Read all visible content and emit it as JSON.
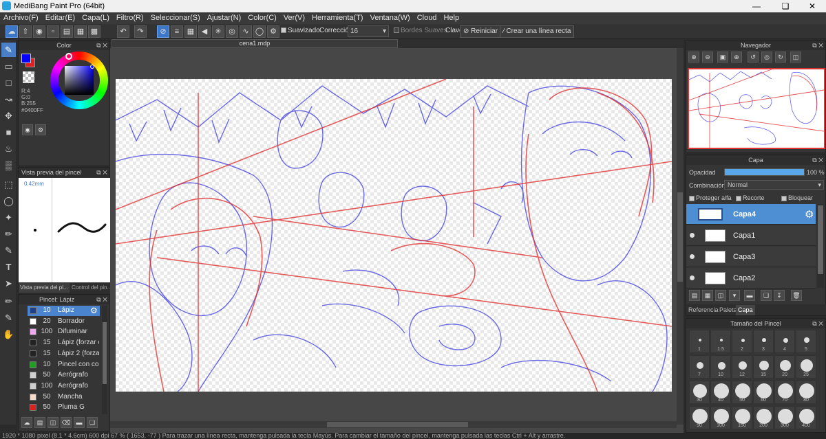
{
  "window": {
    "title": "MediBang Paint Pro (64bit)"
  },
  "menu": [
    "Archivo(F)",
    "Editar(E)",
    "Capa(L)",
    "Filtro(R)",
    "Seleccionar(S)",
    "Ajustar(N)",
    "Color(C)",
    "Ver(V)",
    "Herramienta(T)",
    "Ventana(W)",
    "Cloud",
    "Help"
  ],
  "toolbar": {
    "smoothing_label": "Suavizado",
    "correction_label": "Corrección",
    "correction_value": "16",
    "soft_edges_label": "Bordes Suaves",
    "key_label": "Clave",
    "reset_label": "Reiniciar",
    "straight_line_label": "Crear una línea recta"
  },
  "color_panel": {
    "title": "Color",
    "r": "R:4",
    "g": "G:0",
    "b": "B:255",
    "hex": "#0400FF",
    "primary_color": "#0400ff",
    "secondary_color": "#e02020"
  },
  "brush_preview": {
    "title": "Vista previa del pincel",
    "size": "0.42mm",
    "tab1": "Vista previa del pi...",
    "tab2": "Control del pin..."
  },
  "brush_panel": {
    "title": "Pincel: Lápiz",
    "items": [
      {
        "size": "10",
        "name": "Lápiz",
        "color": "#1e3f8c"
      },
      {
        "size": "20",
        "name": "Borrador",
        "color": "#ffffff"
      },
      {
        "size": "100",
        "name": "Difuminar",
        "color": "#f0a8f0"
      },
      {
        "size": "15",
        "name": "Lápiz (forzar c",
        "color": "#222222"
      },
      {
        "size": "15",
        "name": "Lápiz 2 (forzar",
        "color": "#222222"
      },
      {
        "size": "10",
        "name": "Pincel con cor",
        "color": "#20a020"
      },
      {
        "size": "50",
        "name": "Aerógrafo",
        "color": "#d0d0d0"
      },
      {
        "size": "100",
        "name": "Aerógrafo",
        "color": "#d0d0d0"
      },
      {
        "size": "50",
        "name": "Mancha",
        "color": "#f5dcc8"
      },
      {
        "size": "50",
        "name": "Pluma G",
        "color": "#e02020"
      }
    ]
  },
  "document": {
    "tab": "cena1.mdp"
  },
  "navigator": {
    "title": "Navegador"
  },
  "layer_panel": {
    "title": "Capa",
    "opacity_label": "Opacidad",
    "opacity_value": "100 %",
    "opacity_fraction": 1.0,
    "blend_label": "Combinación",
    "blend_value": "Normal",
    "protect_alpha": "Proteger alfa",
    "clipping": "Recorte",
    "lock": "Bloquear",
    "layers": [
      "Capa4",
      "Capa1",
      "Capa3",
      "Capa2"
    ],
    "tabs": [
      "Referencia",
      "Paleta",
      "Capa"
    ]
  },
  "brush_size_panel": {
    "title": "Tamaño del Pincel",
    "sizes": [
      "1",
      "1.5",
      "2",
      "3",
      "4",
      "5",
      "7",
      "10",
      "12",
      "15",
      "20",
      "25",
      "30",
      "40",
      "50",
      "60",
      "70",
      "80",
      "90",
      "100",
      "150",
      "200",
      "300",
      "400"
    ]
  },
  "status_bar": "1920 * 1080 pixel   (8.1 * 4.6cm)   600 dpi   67 %   ( 1653, -77 )   Para trazar una línea recta, mantenga pulsada la tecla Mayús. Para cambiar el tamaño del pincel, mantenga pulsada las teclas Ctrl + Alt y arrastre."
}
